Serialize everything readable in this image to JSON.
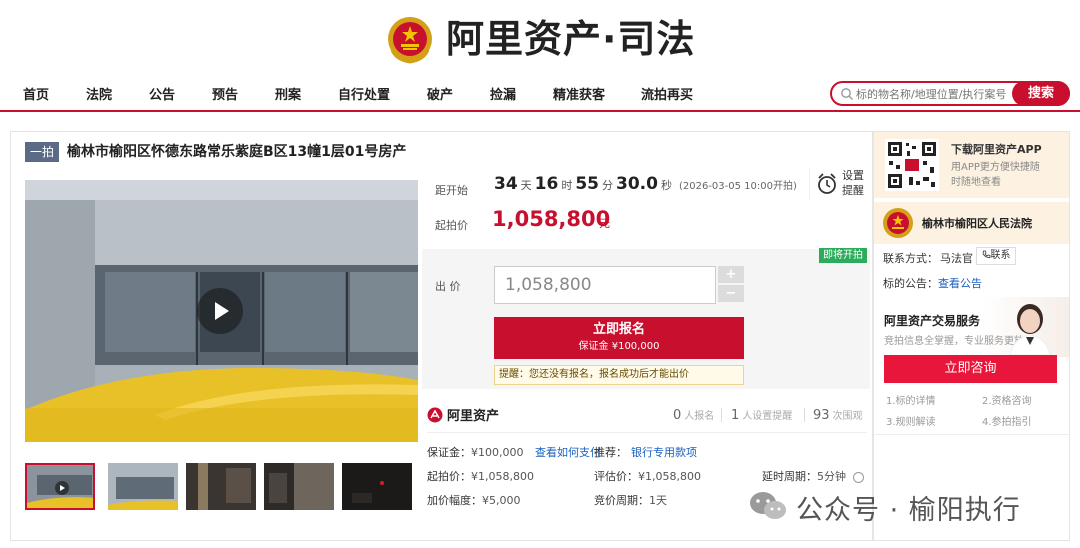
{
  "header": {
    "logo_text": "阿里资产·司法"
  },
  "nav": {
    "items": [
      "首页",
      "法院",
      "公告",
      "预告",
      "刑案",
      "自行处置",
      "破产",
      "捡漏",
      "精准获客",
      "流拍再买"
    ],
    "search_placeholder": "标的物名称/地理位置/执行案号",
    "search_button": "搜索"
  },
  "item": {
    "round_tag": "一拍",
    "title": "榆林市榆阳区怀德东路常乐紫庭B区13幢1层01号房产"
  },
  "countdown": {
    "label": "距开始",
    "days": "34",
    "days_unit": "天",
    "hours": "16",
    "hours_unit": "时",
    "minutes": "55",
    "minutes_unit": "分",
    "seconds": "30.0",
    "seconds_unit": "秒",
    "start_time": "(2026-03-05 10:00开拍)"
  },
  "reminder_toggle": {
    "label": "设置提醒",
    "icon": "alarm-clock-icon"
  },
  "start_price": {
    "label": "起拍价",
    "value": "1,058,800",
    "unit": "元"
  },
  "bid": {
    "badge": "即将开拍",
    "label": "出  价",
    "value": "1,058,800",
    "plus": "+",
    "minus": "−",
    "register_label": "立即报名",
    "deposit_label": "保证金 ¥100,000",
    "notice": "提醒：您还没有报名，报名成功后才能出价"
  },
  "stats": {
    "brand": "阿里资产",
    "registered_count": "0",
    "registered_label": "人报名",
    "reminder_count": "1",
    "reminder_label": "人设置提醒",
    "views_count": "93",
    "views_label": "次围观"
  },
  "details": {
    "deposit_label": "保证金：",
    "deposit_value": "¥100,000",
    "deposit_link": "查看如何支付",
    "recommend_label": "推荐：",
    "recommend_link": "银行专用款项",
    "start_price_label": "起拍价：",
    "start_price_value": "¥1,058,800",
    "appraisal_label": "评估价：",
    "appraisal_value": "¥1,058,800",
    "delay_label": "延时周期：",
    "delay_value": "5分钟",
    "increment_label": "加价幅度：",
    "increment_value": "¥5,000",
    "bid_cycle_label": "竞价周期：",
    "bid_cycle_value": "1天"
  },
  "side": {
    "app_title": "下载阿里资产APP",
    "app_subtitle": "用APP更方便快捷随时随地查看",
    "court_name": "榆林市榆阳区人民法院",
    "contact_label": "联系方式：",
    "contact_name": "马法官",
    "contact_button": "联系",
    "notice_label": "标的公告：",
    "notice_link": "查看公告",
    "service_title": "阿里资产交易服务",
    "service_subtitle": "竞拍信息全掌握，专业服务更放心",
    "consult_button": "立即咨询",
    "steps": [
      "1.标的详情",
      "2.资格咨询",
      "3.规则解读",
      "4.参拍指引"
    ]
  },
  "watermark": {
    "text": "公众号 · 榆阳执行"
  },
  "colors": {
    "brand_red": "#c8102e",
    "consult_red": "#e8163a",
    "link_blue": "#1b5fbe",
    "soon_green": "#2bab5b",
    "tag_slate": "#5b6b86"
  }
}
